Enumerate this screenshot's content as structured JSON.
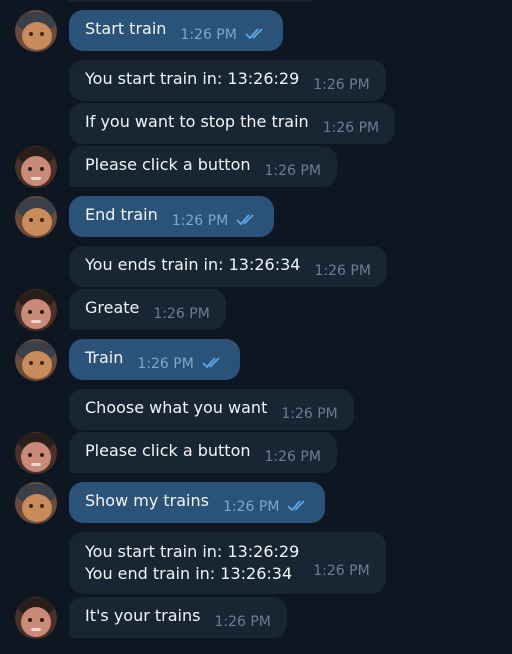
{
  "messages": [
    {
      "text": "Start train",
      "time": "1:26 PM",
      "from": "me",
      "read": true
    },
    {
      "text": "You start train in: 13:26:29",
      "time": "1:26 PM",
      "from": "bot"
    },
    {
      "text": "If you want to stop the train",
      "time": "1:26 PM",
      "from": "bot"
    },
    {
      "text": "Please click a button",
      "time": "1:26 PM",
      "from": "bot"
    },
    {
      "text": "End train",
      "time": "1:26 PM",
      "from": "me",
      "read": true
    },
    {
      "text": "You ends train in: 13:26:34",
      "time": "1:26 PM",
      "from": "bot"
    },
    {
      "text": "Greate",
      "time": "1:26 PM",
      "from": "bot"
    },
    {
      "text": "Train",
      "time": "1:26 PM",
      "from": "me",
      "read": true
    },
    {
      "text": "Choose what you want",
      "time": "1:26 PM",
      "from": "bot"
    },
    {
      "text": "Please click a button",
      "time": "1:26 PM",
      "from": "bot"
    },
    {
      "text": "Show my trains",
      "time": "1:26 PM",
      "from": "me",
      "read": true
    },
    {
      "lines": [
        "You start train in: 13:26:29",
        "You end train in: 13:26:34"
      ],
      "time": "1:26 PM",
      "from": "bot"
    },
    {
      "text": "It's your trains",
      "time": "1:26 PM",
      "from": "bot"
    }
  ],
  "colors": {
    "background": "#0e1621",
    "incoming_bubble": "#182533",
    "outgoing_bubble": "#2b5278",
    "read_check": "#5fa8e8"
  },
  "icons": {
    "read_receipt": "double-check-icon",
    "user_avatar": "user-avatar",
    "bot_avatar": "bot-avatar"
  }
}
